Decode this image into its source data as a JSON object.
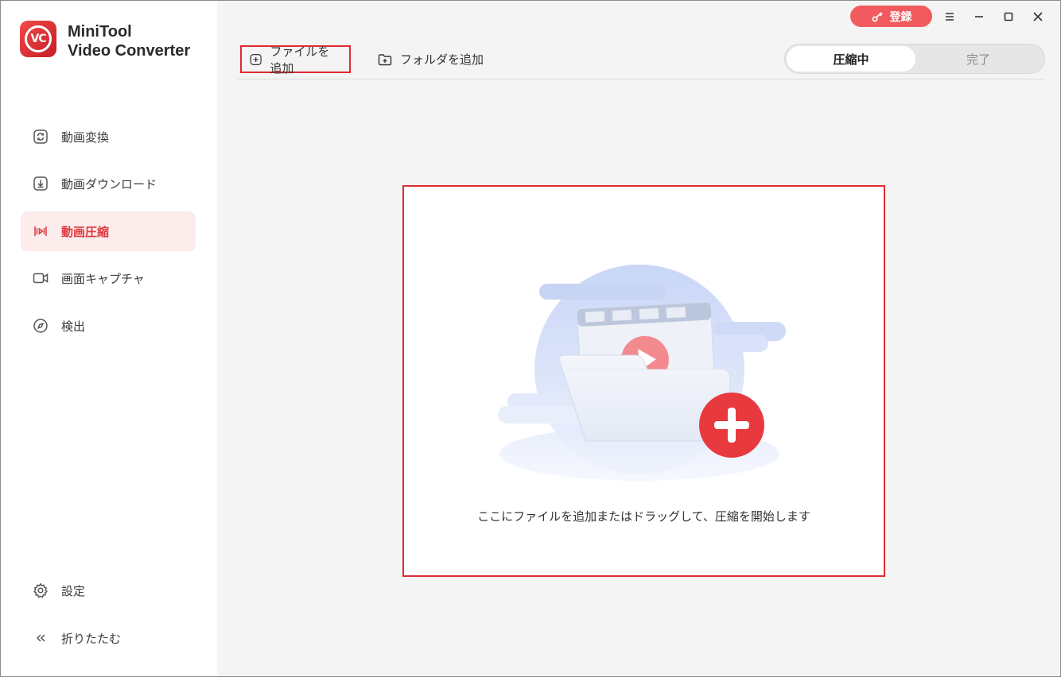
{
  "app": {
    "logo_text": "VC",
    "title_line1": "MiniTool",
    "title_line2": "Video Converter"
  },
  "sidebar": {
    "items": [
      {
        "label": "動画変換",
        "icon": "refresh-icon"
      },
      {
        "label": "動画ダウンロード",
        "icon": "download-icon"
      },
      {
        "label": "動画圧縮",
        "icon": "compress-icon",
        "active": true
      },
      {
        "label": "画面キャプチャ",
        "icon": "video-camera-icon"
      },
      {
        "label": "検出",
        "icon": "compass-icon"
      }
    ],
    "bottom": [
      {
        "label": "設定",
        "icon": "gear-icon"
      },
      {
        "label": "折りたたむ",
        "icon": "chevron-double-left-icon"
      }
    ]
  },
  "titlebar": {
    "register_label": "登録",
    "register_icon": "key-icon"
  },
  "toolbar": {
    "add_file_label": "ファイルを追加",
    "add_folder_label": "フォルダを追加"
  },
  "tabs": {
    "compressing": "圧縮中",
    "done": "完了"
  },
  "dropzone": {
    "hint": "ここにファイルを追加またはドラッグして、圧縮を開始します"
  },
  "colors": {
    "accent": "#e0383e",
    "register_bg": "#f15a5f",
    "active_bg": "#fdecec"
  }
}
